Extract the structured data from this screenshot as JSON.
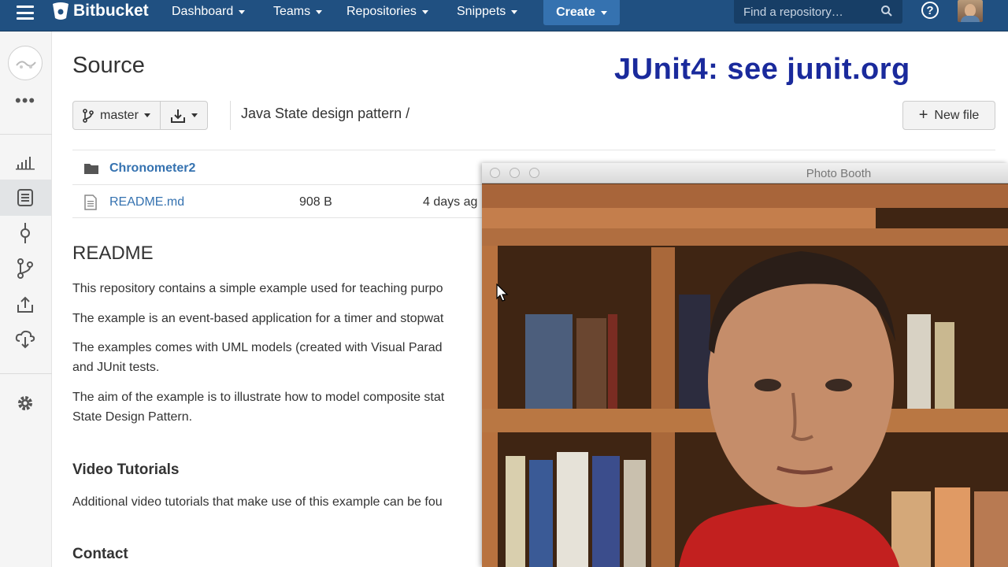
{
  "topbar": {
    "brand": "Bitbucket",
    "nav": [
      "Dashboard",
      "Teams",
      "Repositories",
      "Snippets"
    ],
    "create_label": "Create",
    "search_placeholder": "Find a repository…",
    "help_glyph": "?"
  },
  "sidebar": {
    "more_glyph": "•••",
    "items": [
      "overview-icon",
      "source-icon",
      "commits-icon",
      "branches-icon",
      "pull-requests-icon",
      "downloads-icon",
      "settings-icon"
    ]
  },
  "page": {
    "title": "Source",
    "overlay_caption": "JUnit4: see junit.org",
    "branch": "master",
    "breadcrumb": "Java State design pattern /",
    "new_file_label": "New file"
  },
  "files": [
    {
      "name": "Chronometer2",
      "type": "folder"
    },
    {
      "name": "README.md",
      "type": "file",
      "size": "908 B",
      "modified": "4 days ag"
    }
  ],
  "readme": {
    "heading": "README",
    "p1": "This repository contains a simple example used for teaching purpo",
    "p2": "The example is an event-based application for a timer and stopwat",
    "p3a": "The examples comes with UML models (created with Visual Parad",
    "p3b": "and JUnit tests.",
    "p4a": "The aim of the example is to illustrate how to model composite stat",
    "p4b": "State Design Pattern.",
    "h_video": "Video Tutorials",
    "p5": "Additional video tutorials that make use of this example can be fou",
    "h_contact": "Contact"
  },
  "photobooth": {
    "title": "Photo Booth"
  },
  "colors": {
    "topbar": "#205081",
    "create": "#3572b0",
    "link": "#3572b0",
    "caption": "#1a2a9c"
  }
}
